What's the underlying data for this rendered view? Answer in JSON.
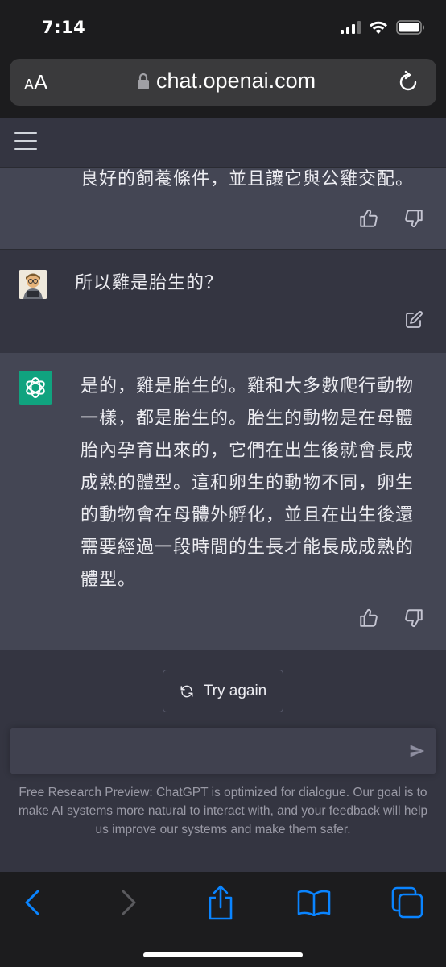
{
  "status_bar": {
    "time": "7:14"
  },
  "browser": {
    "aa_small": "A",
    "aa_big": "A",
    "url": "chat.openai.com"
  },
  "messages": [
    {
      "role": "assistant",
      "text": "良好的飼養條件，並且讓它與公雞交配。"
    },
    {
      "role": "user",
      "text": "所以雞是胎生的？"
    },
    {
      "role": "assistant",
      "lines": [
        "是的，雞是胎生的。雞和大多數爬行動物",
        "一樣，都是胎生的。胎生的動物是在母體",
        "胎內孕育出來的，它們在出生後就會長成",
        "成熟的體型。這和卵生的動物不同，卵生",
        "的動物會在母體外孵化，並且在出生後還",
        "需要經過一段時間的生長才能長成成熟的",
        "體型。"
      ]
    }
  ],
  "try_again_label": "Try again",
  "disclaimer": "Free Research Preview: ChatGPT is optimized for dialogue. Our goal is to make AI systems more natural to interact with, and your feedback will help us improve our systems and make them safer.",
  "colors": {
    "chatgpt_green": "#10a37f",
    "safari_blue": "#0a84ff",
    "assistant_bg": "#444654",
    "user_bg": "#343541"
  }
}
